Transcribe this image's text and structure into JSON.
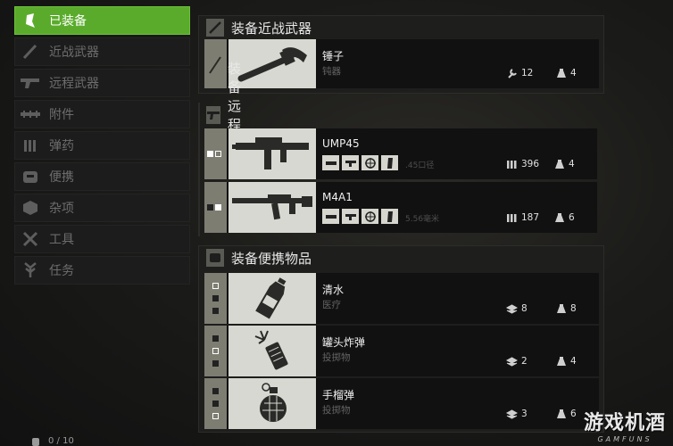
{
  "sidebar": {
    "items": [
      {
        "label": "已装备",
        "icon": "equipped-icon",
        "active": true
      },
      {
        "label": "近战武器",
        "icon": "melee-weapon-icon"
      },
      {
        "label": "远程武器",
        "icon": "pistol-icon"
      },
      {
        "label": "附件",
        "icon": "attachment-icon"
      },
      {
        "label": "弹药",
        "icon": "ammo-icon"
      },
      {
        "label": "便携",
        "icon": "portable-icon"
      },
      {
        "label": "杂项",
        "icon": "misc-box-icon"
      },
      {
        "label": "工具",
        "icon": "tools-icon"
      },
      {
        "label": "任务",
        "icon": "quest-icon"
      }
    ]
  },
  "melee": {
    "title": "装备近战武器",
    "items": [
      {
        "name": "锤子",
        "sub": "钝器",
        "stat1": "12",
        "stat2": "4"
      }
    ]
  },
  "ranged": {
    "title": "装备远程武器",
    "items": [
      {
        "name": "UMP45",
        "ammo": ".45口径",
        "stat1": "396",
        "stat2": "4"
      },
      {
        "name": "M4A1",
        "ammo": "5.56毫米",
        "stat1": "187",
        "stat2": "6"
      }
    ]
  },
  "portable": {
    "title": "装备便携物品",
    "items": [
      {
        "name": "清水",
        "sub": "医疗",
        "stat1": "8",
        "stat2": "8"
      },
      {
        "name": "罐头炸弹",
        "sub": "投掷物",
        "stat1": "2",
        "stat2": "4"
      },
      {
        "name": "手榴弹",
        "sub": "投掷物",
        "stat1": "3",
        "stat2": "6"
      }
    ]
  },
  "footer": {
    "count": "0 / 10"
  },
  "watermark": {
    "main": "游戏机酒",
    "sub": "GAMFUNS"
  },
  "colors": {
    "accent": "#5aab2b",
    "slot": "#7d7d72",
    "thumb": "#d8d8d2"
  }
}
